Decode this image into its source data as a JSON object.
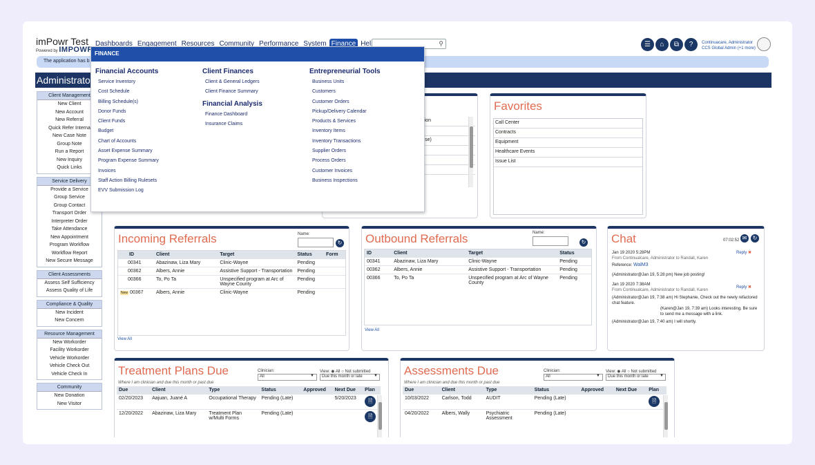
{
  "logo": {
    "title": "imPowr Test",
    "powered": "Powered by",
    "brand": "IMPOWR"
  },
  "nav": {
    "items": [
      "Dashboards",
      "Engagement",
      "Resources",
      "Community",
      "Performance",
      "System",
      "Finance",
      "Help"
    ]
  },
  "user": {
    "name": "Continuacare, Administrator",
    "org": "CCS Global Admin (+1 more)"
  },
  "notice": "The application has b",
  "admin_title": "Administrato",
  "sidebar": {
    "groups": [
      {
        "title": "Client Management",
        "items": [
          "New Client",
          "New Account",
          "New Referral",
          "Quick Refer Interna",
          "New Case Note",
          "Group Note",
          "Run a Report",
          "New Inquiry",
          "Quick Links"
        ]
      },
      {
        "title": "Service Delivery",
        "items": [
          "Provide a Service",
          "Group Service",
          "Group Contact",
          "Transport Order",
          "Interpreter Order",
          "Take Attendance",
          "New Appointment",
          "Program Workflow",
          "Workflow Report",
          "New Secure Message"
        ]
      },
      {
        "title": "Client Assessments",
        "items": [
          "Assess Self Sufficiency",
          "Assess Quality of Life"
        ]
      },
      {
        "title": "Compliance & Quality",
        "items": [
          "New Incident",
          "New Concern"
        ]
      },
      {
        "title": "Resource Management",
        "items": [
          "New Workorder",
          "Facility Workorder",
          "Vehicle Workorder",
          "Vehicle Check Out",
          "Vehicle Check In"
        ]
      },
      {
        "title": "Community",
        "items": [
          "New Donation",
          "New Visitor"
        ]
      }
    ]
  },
  "menu": {
    "header": "FINANCE",
    "columns": [
      [
        {
          "heading": "Financial Accounts",
          "items": [
            "Service Inventory",
            "Cost Schedule",
            "Billing Schedule(s)",
            "Donor Funds",
            "Client Funds",
            "Budget",
            "Chart of Accounts",
            "Asset Expense Summary",
            "Program Expense Summary",
            "Invoices",
            "Staff Action Billing Rulesets",
            "EVV Submission Log"
          ]
        }
      ],
      [
        {
          "heading": "Client Finances",
          "items": [
            "Client & General Ledgers",
            "Client Finance Summary"
          ]
        },
        {
          "heading": "Financial Analysis",
          "items": [
            "Finance Dashboard",
            "Insurance Claims"
          ]
        }
      ],
      [
        {
          "heading": "Entrepreneurial Tools",
          "items": [
            "Business Units",
            "Customers",
            "Customer Orders",
            "Pickup/Delivery Calendar",
            "Products & Services",
            "Inventory Items",
            "Inventory Transactions",
            "Supplier Orders",
            "Process Orders",
            "Customer Invoices",
            "Business Inspections"
          ]
        }
      ]
    ]
  },
  "partial_list": {
    "items": [
      "dation",
      "",
      "ourse)",
      "",
      "",
      ""
    ]
  },
  "favorites": {
    "title": "Favorites",
    "items": [
      "Call Center",
      "Contracts",
      "Equipment",
      "Healthcare Events",
      "Issue List"
    ]
  },
  "incoming": {
    "title": "Incoming Referrals",
    "name_label": "Name:",
    "headers": [
      "ID",
      "Client",
      "Target",
      "Status",
      "Form"
    ],
    "rows": [
      [
        "00341",
        "Abazinaw, Liza Mary",
        "Clinic-Wayne",
        "Pending",
        ""
      ],
      [
        "00362",
        "Albers, Annie",
        "Assistive Support - Transportation",
        "Pending",
        ""
      ],
      [
        "00366",
        "To, Po Ta",
        "Unspecified program at Arc of Wayne County",
        "Pending",
        ""
      ],
      [
        "00367",
        "Albers, Annie",
        "Clinic-Wayne",
        "Pending",
        ""
      ]
    ],
    "new_badge": "New",
    "view_all": "View All"
  },
  "outbound": {
    "title": "Outbound Referrals",
    "name_label": "Name:",
    "headers": [
      "ID",
      "Client",
      "Target",
      "Status"
    ],
    "rows": [
      [
        "00341",
        "Abazinaw, Liza Mary",
        "Clinic-Wayne",
        "Pending"
      ],
      [
        "00362",
        "Albers, Annie",
        "Assistive Support - Transportation",
        "Pending"
      ],
      [
        "00366",
        "To, Po Ta",
        "Unspecified program at Arc of Wayne County",
        "Pending"
      ]
    ],
    "view_all": "View All"
  },
  "chat": {
    "title": "Chat",
    "time": "07:02:52",
    "m1_date": "Jan 19 2020 5:28PM",
    "m1_from": "From Continualcare, Administrator to Randall, Karen",
    "m1_ref_label": "Reference:",
    "m1_ref": "WalM3",
    "reply": "Reply",
    "m1_body": "(Administrator@Jan 19, 5:28 pm) New job posting!",
    "m2_date": "Jan 19 2020 7:38AM",
    "m2_from": "From Continualcare, Administrator to Randall, Karen",
    "m2_b1": "(Administrator@Jan 19, 7:38 am) Hi Stephanie, Check out the newly refactored chat feature.",
    "m2_b2": "(Karen@Jan 19, 7:39 am) Looks interesting. Be sure to send me a message with a link.",
    "m2_b3": "(Administrator@Jan 19, 7:40 am) I will shortly."
  },
  "treatment": {
    "title": "Treatment Plans Due",
    "sub": "Where I am clinician and due this month or past due",
    "clinician_label": "Clinician:",
    "clinician_value": "All",
    "view_label": "View:",
    "view_all": "All",
    "view_ns": "Not submitted",
    "due_select": "Due this month or late",
    "headers": [
      "Due",
      "Client",
      "Type",
      "Status",
      "Approved",
      "Next Due",
      "Plan"
    ],
    "rows": [
      [
        "02/20/2023",
        "Aajuan, Juané A",
        "Occupational Therapy",
        "Pending (Late)",
        "",
        "5/20/2023"
      ],
      [
        "12/20/2022",
        "Abazinaw, Liza Mary",
        "Treatment Plan w/Multi Forms",
        "Pending (Late)",
        "",
        ""
      ]
    ]
  },
  "assessments": {
    "title": "Assessments Due",
    "sub": "Where I am clinician and due this month or past due",
    "clinician_label": "Clinician:",
    "clinician_value": "All",
    "view_label": "View:",
    "view_all": "All",
    "view_ns": "Not submitted",
    "due_select": "Due this month or late",
    "headers": [
      "Due",
      "Client",
      "Type",
      "Status",
      "Approved",
      "Next Due",
      "Plan"
    ],
    "rows": [
      [
        "10/03/2022",
        "Carlson, Todd",
        "AUDIT",
        "Pending (Late)",
        "",
        ""
      ],
      [
        "04/20/2022",
        "Albers, Wally",
        "Psychiatric Assessment",
        "Pending (Late)",
        "",
        ""
      ]
    ]
  }
}
